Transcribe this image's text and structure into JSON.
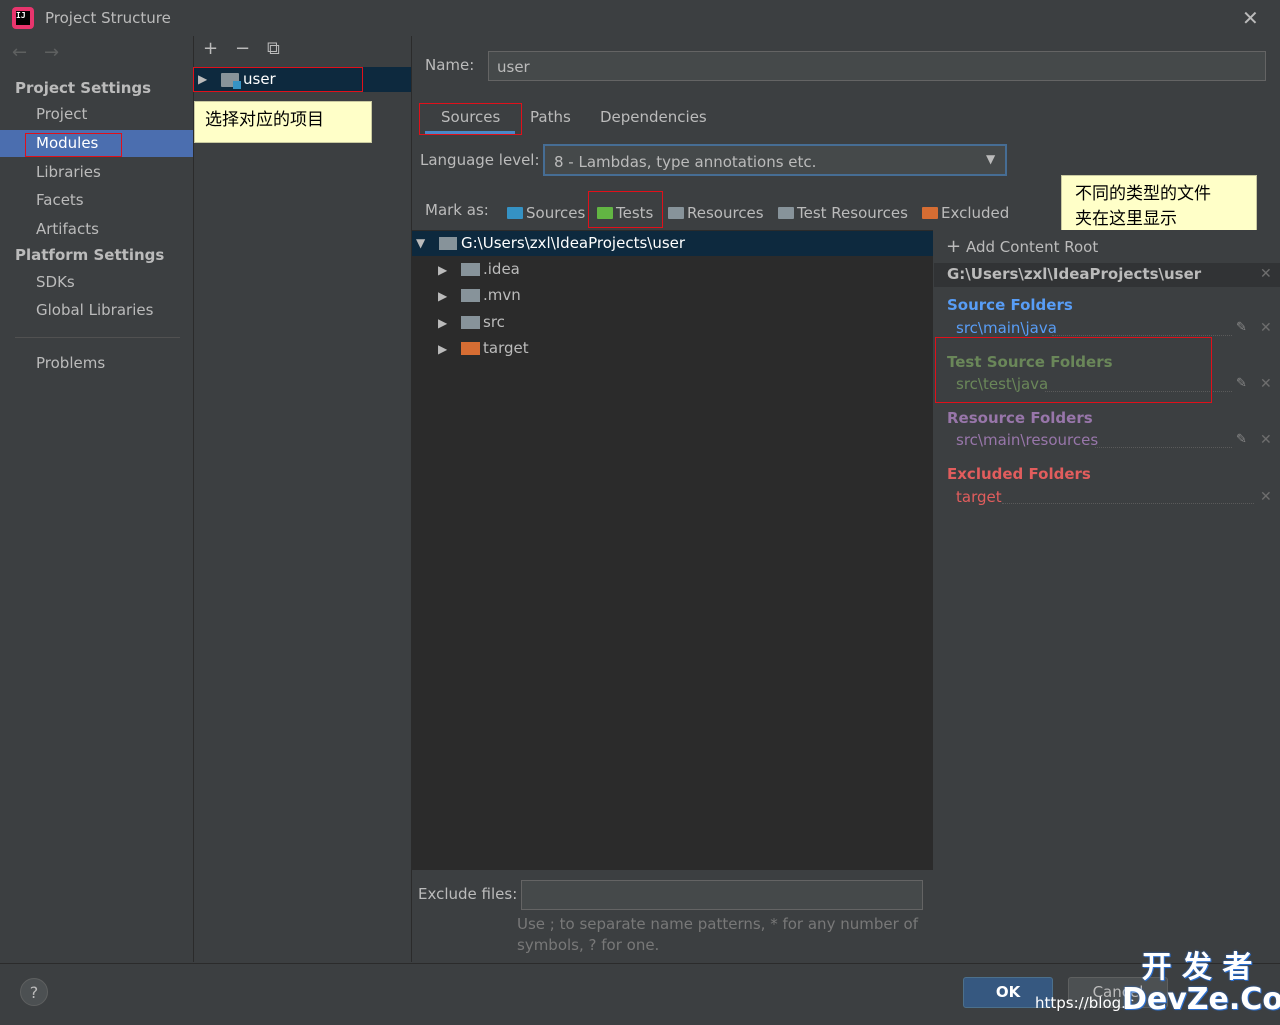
{
  "window": {
    "title": "Project Structure",
    "close_glyph": "✕",
    "app_icon_text": "IJ"
  },
  "nav": {
    "back_glyph": "←",
    "forward_glyph": "→",
    "project_settings_header": "Project Settings",
    "platform_settings_header": "Platform Settings",
    "items": {
      "project": "Project",
      "modules": "Modules",
      "libraries": "Libraries",
      "facets": "Facets",
      "artifacts": "Artifacts",
      "sdks": "SDKs",
      "global_libraries": "Global Libraries",
      "problems": "Problems"
    },
    "selected": "modules"
  },
  "module_list": {
    "add_glyph": "+",
    "remove_glyph": "−",
    "copy_glyph": "⧉",
    "module_name": "user"
  },
  "annotations": {
    "select_project": "选择对应的项目",
    "folder_types_line1": "不同的类型的文件",
    "folder_types_line2": "夹在这里显示"
  },
  "module": {
    "name_label": "Name:",
    "name_value": "user",
    "tabs": [
      "Sources",
      "Paths",
      "Dependencies"
    ],
    "active_tab": "Sources",
    "language_level_label": "Language level:",
    "language_level_value": "8 - Lambdas, type annotations etc.",
    "mark_as_label": "Mark as:",
    "mark_as": {
      "sources": "Sources",
      "tests": "Tests",
      "resources": "Resources",
      "test_resources": "Test Resources",
      "excluded": "Excluded"
    }
  },
  "tree": {
    "root": "G:\\Users\\zxl\\IdeaProjects\\user",
    "children": [
      ".idea",
      ".mvn",
      "src",
      "target"
    ]
  },
  "content_root": {
    "add_label": "Add Content Root",
    "path": "G:\\Users\\zxl\\IdeaProjects\\user",
    "source_folders_title": "Source Folders",
    "source_folder": "src\\main\\java",
    "test_folders_title": "Test Source Folders",
    "test_folder": "src\\test\\java",
    "resource_folders_title": "Resource Folders",
    "resource_folder": "src\\main\\resources",
    "excluded_folders_title": "Excluded Folders",
    "excluded_folder": "target"
  },
  "exclude": {
    "label": "Exclude files:",
    "value": "",
    "hint_line1": "Use ; to separate name patterns, * for any number of",
    "hint_line2": "symbols, ? for one."
  },
  "footer": {
    "help": "?",
    "ok": "OK",
    "cancel": "Cancel",
    "watermark_url": "https://blog.c",
    "watermark_logo_line1": "开 发 者",
    "watermark_logo_line2": "DevZe.CoM"
  },
  "colors": {
    "sources": "#589df6",
    "tests": "#6a8759",
    "resources": "#9876aa",
    "excluded": "#e25d5d",
    "selection": "#4b6eaf",
    "annotation_red": "#e0101a"
  }
}
